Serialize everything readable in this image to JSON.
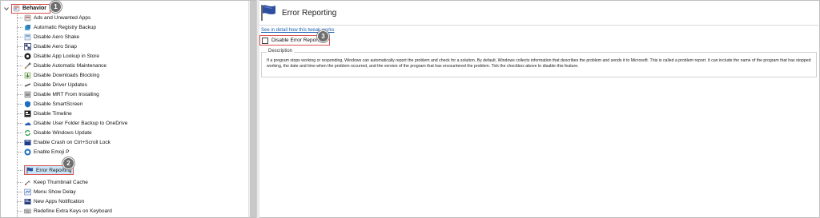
{
  "tree": {
    "root_label": "Behavior",
    "items": [
      {
        "label": "Ads and Unwanted Apps",
        "icon": "ads-icon"
      },
      {
        "label": "Automatic Registry Backup",
        "icon": "registry-icon"
      },
      {
        "label": "Disable Aero Shake",
        "icon": "aero-shake-icon"
      },
      {
        "label": "Disable Aero Snap",
        "icon": "aero-snap-icon"
      },
      {
        "label": "Disable App Lookup in Store",
        "icon": "store-icon"
      },
      {
        "label": "Disable Automatic Maintenance",
        "icon": "maintenance-icon"
      },
      {
        "label": "Disable Downloads Blocking",
        "icon": "downloads-icon"
      },
      {
        "label": "Disable Driver Updates",
        "icon": "driver-icon"
      },
      {
        "label": "Disable MRT From Installing",
        "icon": "mrt-icon"
      },
      {
        "label": "Disable SmartScreen",
        "icon": "smartscreen-icon"
      },
      {
        "label": "Disable Timeline",
        "icon": "timeline-icon"
      },
      {
        "label": "Disable User Folder Backup to OneDrive",
        "icon": "onedrive-icon"
      },
      {
        "label": "Disable Windows Update",
        "icon": "windows-update-icon"
      },
      {
        "label": "Enable Crash on Ctrl+Scroll Lock",
        "icon": "crash-icon"
      },
      {
        "label": "Enable Emoji P",
        "icon": "emoji-icon"
      },
      {
        "label": "Error Reporting",
        "icon": "flag-icon",
        "selected": true
      },
      {
        "label": "Keep Thumbnail Cache",
        "icon": "thumbnail-icon"
      },
      {
        "label": "Menu Show Delay",
        "icon": "menu-delay-icon"
      },
      {
        "label": "New Apps Notification",
        "icon": "notification-icon"
      },
      {
        "label": "Redefine Extra Keys on Keyboard",
        "icon": "keyboard-icon"
      }
    ]
  },
  "badges": {
    "one": "1",
    "two": "2",
    "three": "3"
  },
  "panel": {
    "title": "Error Reporting",
    "link": "See in detail how this tweak works",
    "checkbox_label": "Disable Error Reporting",
    "checkbox_checked": false,
    "description_legend": "Description",
    "description_text": "If a program stops working or responding, Windows can automatically report the problem and check for a solution. By default, Windows collects information that describes the problem and sends it to Microsoft. This is called a problem report. It can include the name of the program that has stopped working, the date and time when the problem occurred, and the version of the program that has encountered the problem. Tick the checkbox above to disable this feature."
  },
  "colors": {
    "highlight_border": "#d9534f",
    "selection_bg": "#cce4f7",
    "link": "#1a5fb4",
    "badge": "#6e6e6e"
  }
}
